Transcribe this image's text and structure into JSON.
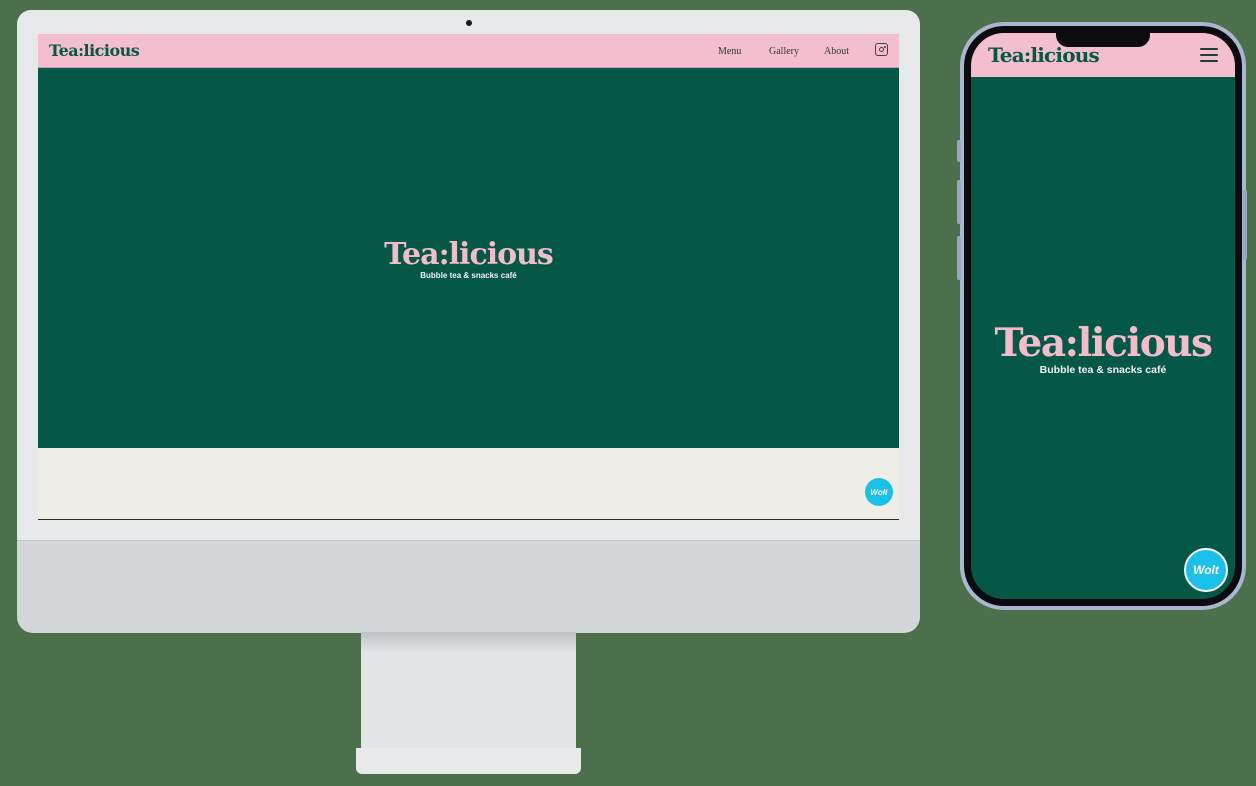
{
  "desktop": {
    "logo": "Tea:licious",
    "nav": {
      "menu_label": "Menu",
      "gallery_label": "Gallery",
      "about_label": "About",
      "instagram_icon": "instagram-icon"
    },
    "hero": {
      "title": "Tea:licious",
      "subtitle": "Bubble tea & snacks café"
    },
    "wolt_label": "Wolt"
  },
  "mobile": {
    "logo": "Tea:licious",
    "menu_icon": "hamburger-menu-icon",
    "hero": {
      "title": "Tea:licious",
      "subtitle": "Bubble tea & snacks café"
    },
    "wolt_label": "Wolt"
  },
  "colors": {
    "brand_green": "#055746",
    "brand_pink": "#f3bfcf",
    "wolt_blue": "#1ac0e8",
    "cream": "#eeeee6"
  }
}
